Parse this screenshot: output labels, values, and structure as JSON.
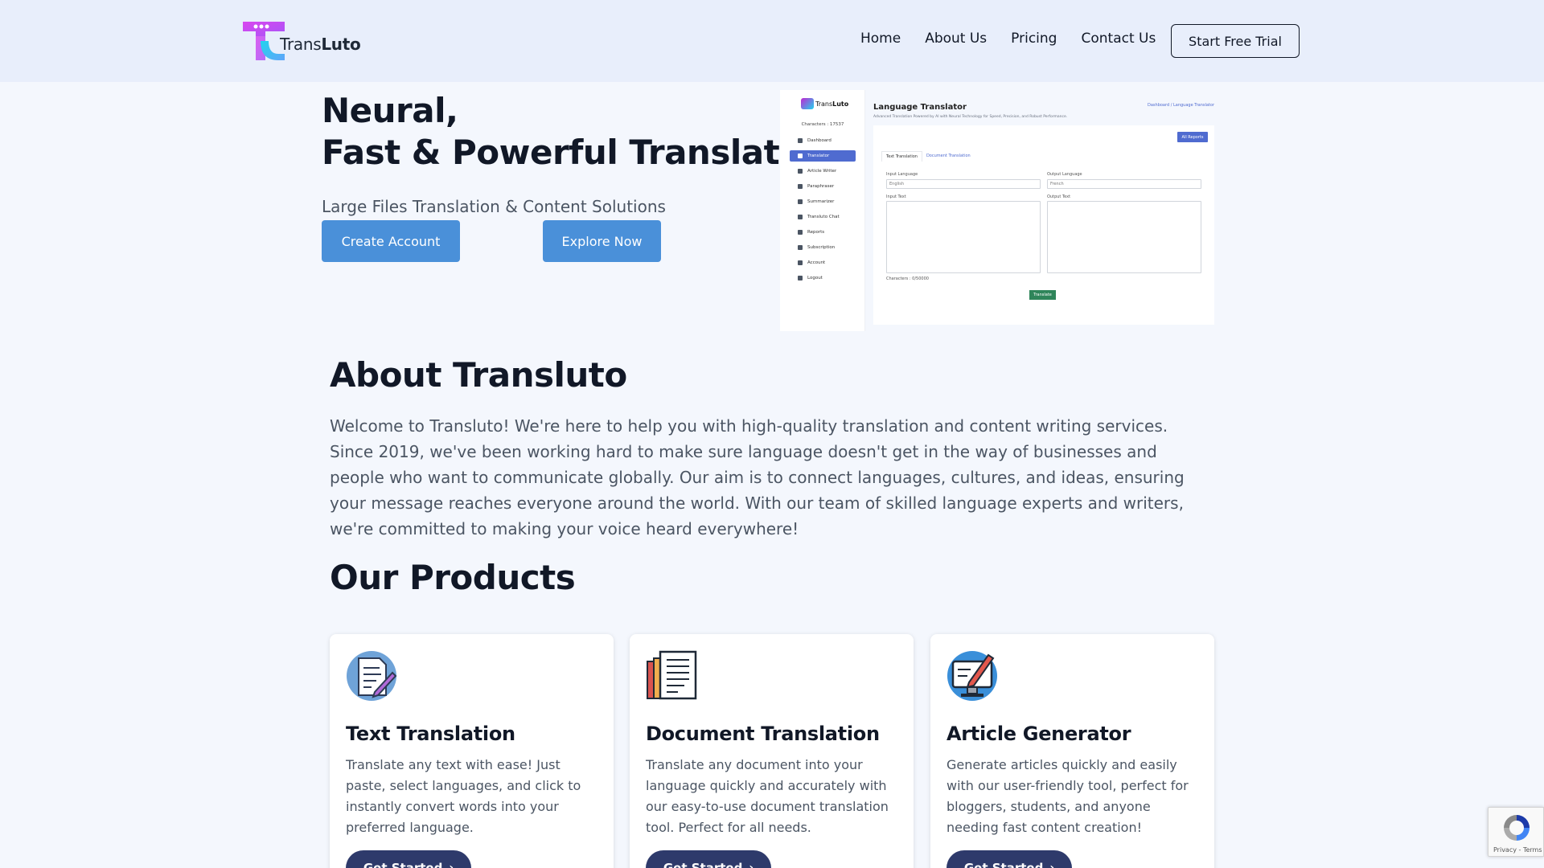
{
  "brand": {
    "name_light": "Trans",
    "name_bold": "Luto",
    "colors": {
      "magenta": "#c026d3",
      "cyan": "#22d3ee"
    }
  },
  "nav": {
    "links": [
      "Home",
      "About Us",
      "Pricing",
      "Contact Us"
    ],
    "trial_label": "Start Free Trial"
  },
  "hero": {
    "title_line1": "Neural,",
    "title_line2": "Fast & Powerful Translation",
    "subtitle": "Large Files Translation & Content Solutions",
    "create_label": "Create Account",
    "explore_label": "Explore Now",
    "accent": "#4a90d9"
  },
  "preview": {
    "logo_light": "Trans",
    "logo_bold": "Luto",
    "characters": "Characters : 17537",
    "sidebar": [
      "Dashboard",
      "Translator",
      "Article Writer",
      "Paraphraser",
      "Summarizer",
      "Transluto Chat",
      "Reports",
      "Subscription",
      "Account",
      "Logout"
    ],
    "active_item": "Translator",
    "title": "Language Translator",
    "breadcrumb": "Dashboard  /  Language Translator",
    "description": "Advanced Translation Powered by AI with Neural Technology for Speed, Precision, and Robust Performance.",
    "all_reports": "All Reports",
    "tabs": [
      "Text Translation",
      "Document Translation"
    ],
    "input_language_label": "Input Language",
    "output_language_label": "Output Language",
    "input_language_value": "English",
    "output_language_value": "French",
    "input_text_label": "Input Text",
    "output_text_label": "Output Text",
    "char_count": "Characters : 0/50000",
    "translate_label": "Translate"
  },
  "about": {
    "title": "About Transluto",
    "text": "Welcome to Transluto! We're here to help you with high-quality translation and content writing services. Since 2019, we've been working hard to make sure language doesn't get in the way of businesses and people who want to communicate globally. Our aim is to connect languages, cultures, and ideas, ensuring your message reaches everyone around the world. With our team of skilled language experts and writers, we're committed to making your voice heard everywhere!"
  },
  "products": {
    "title": "Our Products",
    "items": [
      {
        "icon": "document-pencil-icon",
        "title": "Text Translation",
        "description": "Translate any text with ease! Just paste, select languages, and click to instantly convert words into your preferred language.",
        "button": "Get Started"
      },
      {
        "icon": "books-document-icon",
        "title": "Document Translation",
        "description": "Translate any document into your language quickly and accurately with our easy-to-use document translation tool. Perfect for all needs.",
        "button": "Get Started"
      },
      {
        "icon": "monitor-pen-icon",
        "title": "Article Generator",
        "description": "Generate articles quickly and easily with our user-friendly tool, perfect for bloggers, students, and anyone needing fast content creation!",
        "button": "Get Started"
      }
    ],
    "button_color": "#2e3a6b"
  },
  "recaptcha": {
    "text": "Privacy - Terms"
  }
}
